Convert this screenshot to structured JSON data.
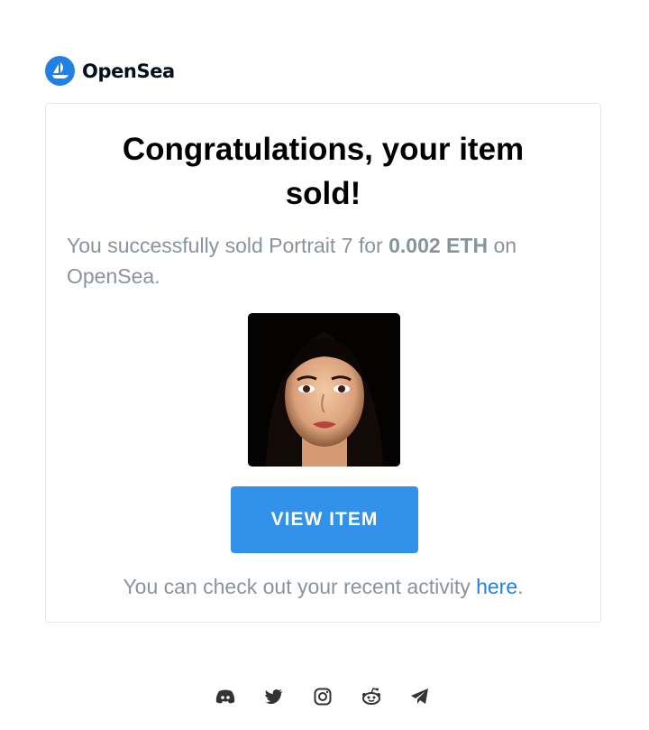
{
  "brand": {
    "name": "OpenSea",
    "color": "#2081e2"
  },
  "email": {
    "title": "Congratulations, your item sold!",
    "message_prefix": "You successfully sold Portrait 7 for ",
    "price": "0.002 ETH",
    "message_suffix": " on OpenSea.",
    "item_image_icon": "portrait-image",
    "button_label": "VIEW ITEM",
    "button_color": "#3291e9",
    "footnote_prefix": "You can check out your recent activity ",
    "footnote_link": "here",
    "footnote_suffix": "."
  },
  "social": [
    "discord-icon",
    "twitter-icon",
    "instagram-icon",
    "reddit-icon",
    "telegram-icon"
  ]
}
